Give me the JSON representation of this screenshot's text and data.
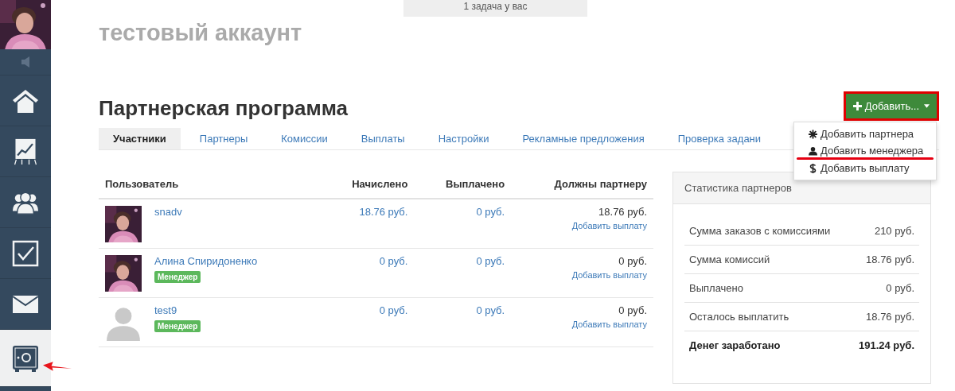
{
  "sidebar": {
    "items": [
      {
        "kind": "speaker",
        "selected": false,
        "arrow": false
      },
      {
        "kind": "home",
        "selected": false,
        "arrow": false
      },
      {
        "kind": "chart",
        "selected": false,
        "arrow": false
      },
      {
        "kind": "users",
        "selected": false,
        "arrow": false
      },
      {
        "kind": "check",
        "selected": false,
        "arrow": false
      },
      {
        "kind": "mail",
        "selected": false,
        "arrow": false
      },
      {
        "kind": "safe",
        "selected": true,
        "arrow": true
      }
    ]
  },
  "task_banner": "1 задача у вас",
  "account_name": "тестовый аккаунт",
  "page_title": "Партнерская программа",
  "add_button": {
    "label": "Добавить...",
    "highlighted": true
  },
  "add_menu": [
    {
      "kind": "asterisk",
      "label": "Добавить партнера",
      "underlined": false
    },
    {
      "kind": "person",
      "label": "Добавить менеджера",
      "underlined": true
    },
    {
      "kind": "dollar",
      "label": "Добавить выплату",
      "underlined": false
    }
  ],
  "tabs": [
    {
      "label": "Участники",
      "selected": true
    },
    {
      "label": "Партнеры",
      "selected": false
    },
    {
      "label": "Комиссии",
      "selected": false
    },
    {
      "label": "Выплаты",
      "selected": false
    },
    {
      "label": "Настройки",
      "selected": false
    },
    {
      "label": "Рекламные предложения",
      "selected": false
    },
    {
      "label": "Проверка задани",
      "selected": false
    }
  ],
  "table": {
    "columns": [
      "Пользователь",
      "Начислено",
      "Выплачено",
      "Должны партнеру"
    ],
    "rows": [
      {
        "has_photo": true,
        "user": "snadv",
        "badge": null,
        "accrued": "18.76 руб.",
        "paid": "0 руб.",
        "owed": "18.76 руб.",
        "action": "Добавить выплату"
      },
      {
        "has_photo": true,
        "user": "Алина Спиридоненко",
        "badge": "Менеджер",
        "accrued": "0 руб.",
        "paid": "0 руб.",
        "owed": "0 руб.",
        "action": "Добавить выплату"
      },
      {
        "has_photo": false,
        "user": "test9",
        "badge": "Менеджер",
        "accrued": "0 руб.",
        "paid": "0 руб.",
        "owed": "0 руб.",
        "action": "Добавить выплату"
      }
    ]
  },
  "stats": {
    "title": "Статистика партнеров",
    "rows": [
      {
        "label": "Сумма заказов с комиссиями",
        "value": "210 руб.",
        "bold": false
      },
      {
        "label": "Сумма комиссий",
        "value": "18.76 руб.",
        "bold": false
      },
      {
        "label": "Выплачено",
        "value": "0 руб.",
        "bold": false
      },
      {
        "label": "Осталось выплатить",
        "value": "18.76 руб.",
        "bold": false
      },
      {
        "label": "Денег заработано",
        "value": "191.24 руб.",
        "bold": true
      }
    ]
  }
}
